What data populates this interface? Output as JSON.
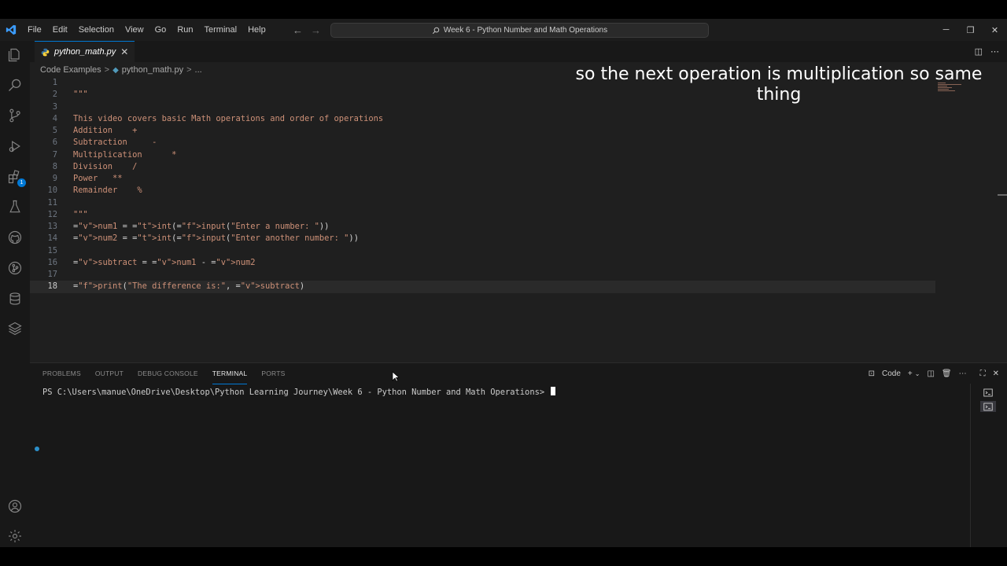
{
  "menu": [
    "File",
    "Edit",
    "Selection",
    "View",
    "Go",
    "Run",
    "Terminal",
    "Help"
  ],
  "command_center": "Week 6 - Python Number and Math Operations",
  "tab": {
    "label": "python_math.py",
    "close": "✕"
  },
  "breadcrumb": {
    "folder": "Code Examples",
    "file": "python_math.py",
    "more": "..."
  },
  "activity_badge": "1",
  "code": [
    {
      "n": "1",
      "t": ""
    },
    {
      "n": "2",
      "t": "\"\"\""
    },
    {
      "n": "3",
      "t": ""
    },
    {
      "n": "4",
      "t": "This video covers basic Math operations and order of operations"
    },
    {
      "n": "5",
      "t": "Addition    +"
    },
    {
      "n": "6",
      "t": "Subtraction     -"
    },
    {
      "n": "7",
      "t": "Multiplication      *"
    },
    {
      "n": "8",
      "t": "Division    /"
    },
    {
      "n": "9",
      "t": "Power   **"
    },
    {
      "n": "10",
      "t": "Remainder    %"
    },
    {
      "n": "11",
      "t": ""
    },
    {
      "n": "12",
      "t": "\"\"\""
    },
    {
      "n": "13",
      "t": "num1 = int(input(\"Enter a number: \"))"
    },
    {
      "n": "14",
      "t": "num2 = int(input(\"Enter another number: \"))"
    },
    {
      "n": "15",
      "t": ""
    },
    {
      "n": "16",
      "t": "subtract = num1 - num2"
    },
    {
      "n": "17",
      "t": ""
    },
    {
      "n": "18",
      "t": "print(\"The difference is:\", subtract)"
    }
  ],
  "caption": "so the next operation is multiplication so same thing",
  "panel": {
    "tabs": [
      "PROBLEMS",
      "OUTPUT",
      "DEBUG CONSOLE",
      "TERMINAL",
      "PORTS"
    ],
    "active_tab": "TERMINAL",
    "shell_label": "Code",
    "terminal_prompt": "PS C:\\Users\\manue\\OneDrive\\Desktop\\Python Learning Journey\\Week 6 - Python Number and Math Operations> "
  },
  "colors": {
    "accent": "#0078d4",
    "string": "#ce9178",
    "variable": "#9cdcfe",
    "function": "#dcdcaa",
    "type": "#4ec9b0"
  }
}
